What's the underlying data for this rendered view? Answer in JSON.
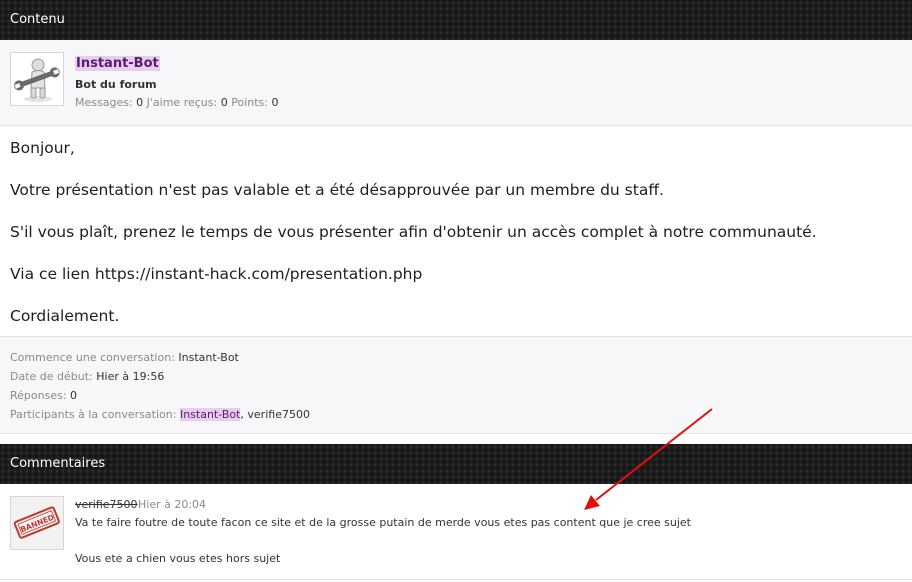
{
  "content_header": "Contenu",
  "author": {
    "name": "Instant-Bot",
    "title": "Bot du forum",
    "stats": {
      "messages_label": "Messages:",
      "messages_value": "0",
      "likes_label": "J'aime reçus:",
      "likes_value": "0",
      "points_label": "Points:",
      "points_value": "0"
    },
    "avatar_icon": "robot-wrench-icon"
  },
  "message": {
    "paragraphs": [
      "Bonjour,",
      "Votre présentation n'est pas valable et a été désapprouvée par un membre du staff.",
      "S'il vous plaît, prenez le temps de vous présenter afin d'obtenir un accès complet à notre communauté.",
      "Via ce lien https://instant-hack.com/presentation.php",
      "Cordialement."
    ]
  },
  "conversation": {
    "started_by_label": "Commence une conversation:",
    "started_by_value": "Instant-Bot",
    "start_date_label": "Date de début:",
    "start_date_value": "Hier à 19:56",
    "replies_label": "Réponses:",
    "replies_value": "0",
    "participants_label": "Participants à la conversation:",
    "participant_1": "Instant-Bot",
    "participant_sep": ", ",
    "participant_2": "verifie7500"
  },
  "comments_header": "Commentaires",
  "comment": {
    "author": "verifie7500",
    "time": "Hier à 20:04",
    "line1": "Va te faire foutre de toute facon ce site et de la grosse putain de merde vous etes pas content que je cree sujet",
    "line2": "Vous ete a chien vous etes hors sujet",
    "avatar_text": "BANNED",
    "avatar_icon": "banned-stamp-icon"
  },
  "colors": {
    "header_bg": "#1c1c1c",
    "username_highlight": "#e7cdee",
    "username_text": "#5a1c70",
    "annotation_arrow": "#e01010",
    "banned_red": "#c0392b"
  }
}
